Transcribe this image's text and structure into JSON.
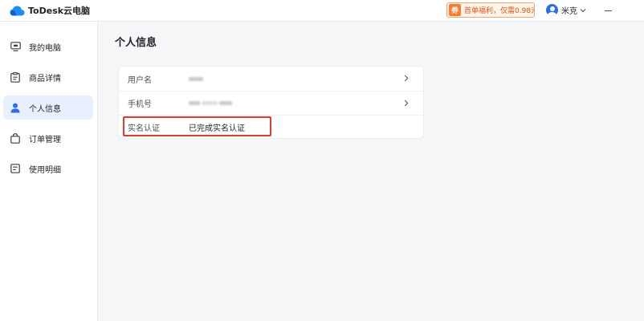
{
  "app": {
    "name": "ToDesk云电脑",
    "brand_color": "#1f8bf5"
  },
  "titlebar": {
    "promo": {
      "badge": "券",
      "text": "首单福利，仅需0.98元"
    },
    "user": {
      "name": "米克",
      "avatar_icon": "avatar-icon"
    },
    "controls": {
      "minimize_icon": "minimize-icon"
    }
  },
  "sidebar": {
    "items": [
      {
        "label": "我的电脑",
        "icon": "monitor-icon",
        "active": false
      },
      {
        "label": "商品详情",
        "icon": "clipboard-icon",
        "active": false
      },
      {
        "label": "个人信息",
        "icon": "user-icon",
        "active": true
      },
      {
        "label": "订单管理",
        "icon": "bag-icon",
        "active": false
      },
      {
        "label": "使用明细",
        "icon": "list-icon",
        "active": false
      }
    ]
  },
  "main": {
    "title": "个人信息",
    "rows": [
      {
        "label": "用户名",
        "value": "",
        "masked": true
      },
      {
        "label": "手机号",
        "value": "",
        "masked": true
      },
      {
        "label": "实名认证",
        "value": "已完成实名认证"
      }
    ],
    "highlight_color": "#e03a32"
  }
}
